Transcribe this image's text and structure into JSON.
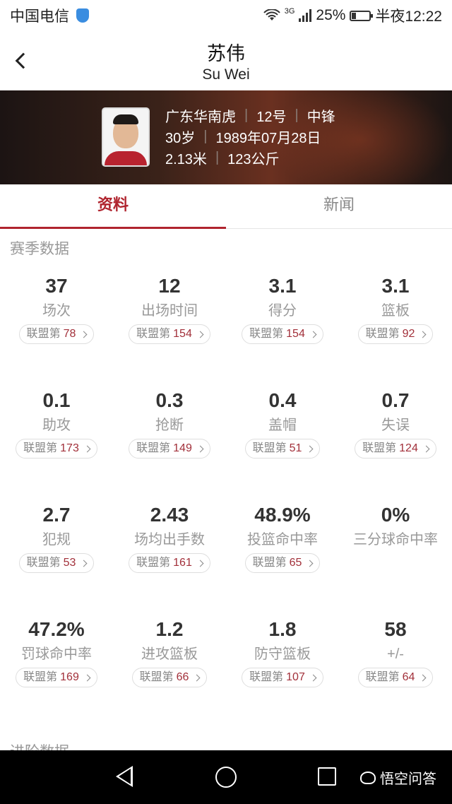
{
  "status_bar": {
    "carrier": "中国电信",
    "network": "3G",
    "battery": "25%",
    "battery_level": 0.25,
    "time": "半夜12:22"
  },
  "header": {
    "title_cn": "苏伟",
    "title_en": "Su Wei"
  },
  "player": {
    "team": "广东华南虎",
    "number": "12号",
    "position": "中锋",
    "age": "30岁",
    "birthday": "1989年07月28日",
    "height": "2.13米",
    "weight": "123公斤"
  },
  "tabs": [
    {
      "label": "资料",
      "active": true
    },
    {
      "label": "新闻",
      "active": false
    }
  ],
  "section_title": "赛季数据",
  "rank_prefix": "联盟第",
  "stats": [
    {
      "value": "37",
      "label": "场次",
      "rank": "78"
    },
    {
      "value": "12",
      "label": "出场时间",
      "rank": "154"
    },
    {
      "value": "3.1",
      "label": "得分",
      "rank": "154"
    },
    {
      "value": "3.1",
      "label": "篮板",
      "rank": "92"
    },
    {
      "value": "0.1",
      "label": "助攻",
      "rank": "173"
    },
    {
      "value": "0.3",
      "label": "抢断",
      "rank": "149"
    },
    {
      "value": "0.4",
      "label": "盖帽",
      "rank": "51"
    },
    {
      "value": "0.7",
      "label": "失误",
      "rank": "124"
    },
    {
      "value": "2.7",
      "label": "犯规",
      "rank": "53"
    },
    {
      "value": "2.43",
      "label": "场均出手数",
      "rank": "161"
    },
    {
      "value": "48.9%",
      "label": "投篮命中率",
      "rank": "65"
    },
    {
      "value": "0%",
      "label": "三分球命中率",
      "rank": null
    },
    {
      "value": "47.2%",
      "label": "罚球命中率",
      "rank": "169"
    },
    {
      "value": "1.2",
      "label": "进攻篮板",
      "rank": "66"
    },
    {
      "value": "1.8",
      "label": "防守篮板",
      "rank": "107"
    },
    {
      "value": "58",
      "label": "+/-",
      "rank": "64"
    }
  ],
  "next_section_title": "进阶数据",
  "watermark": "悟空问答",
  "colors": {
    "accent": "#b0242e",
    "rank_number": "#a2303a"
  }
}
